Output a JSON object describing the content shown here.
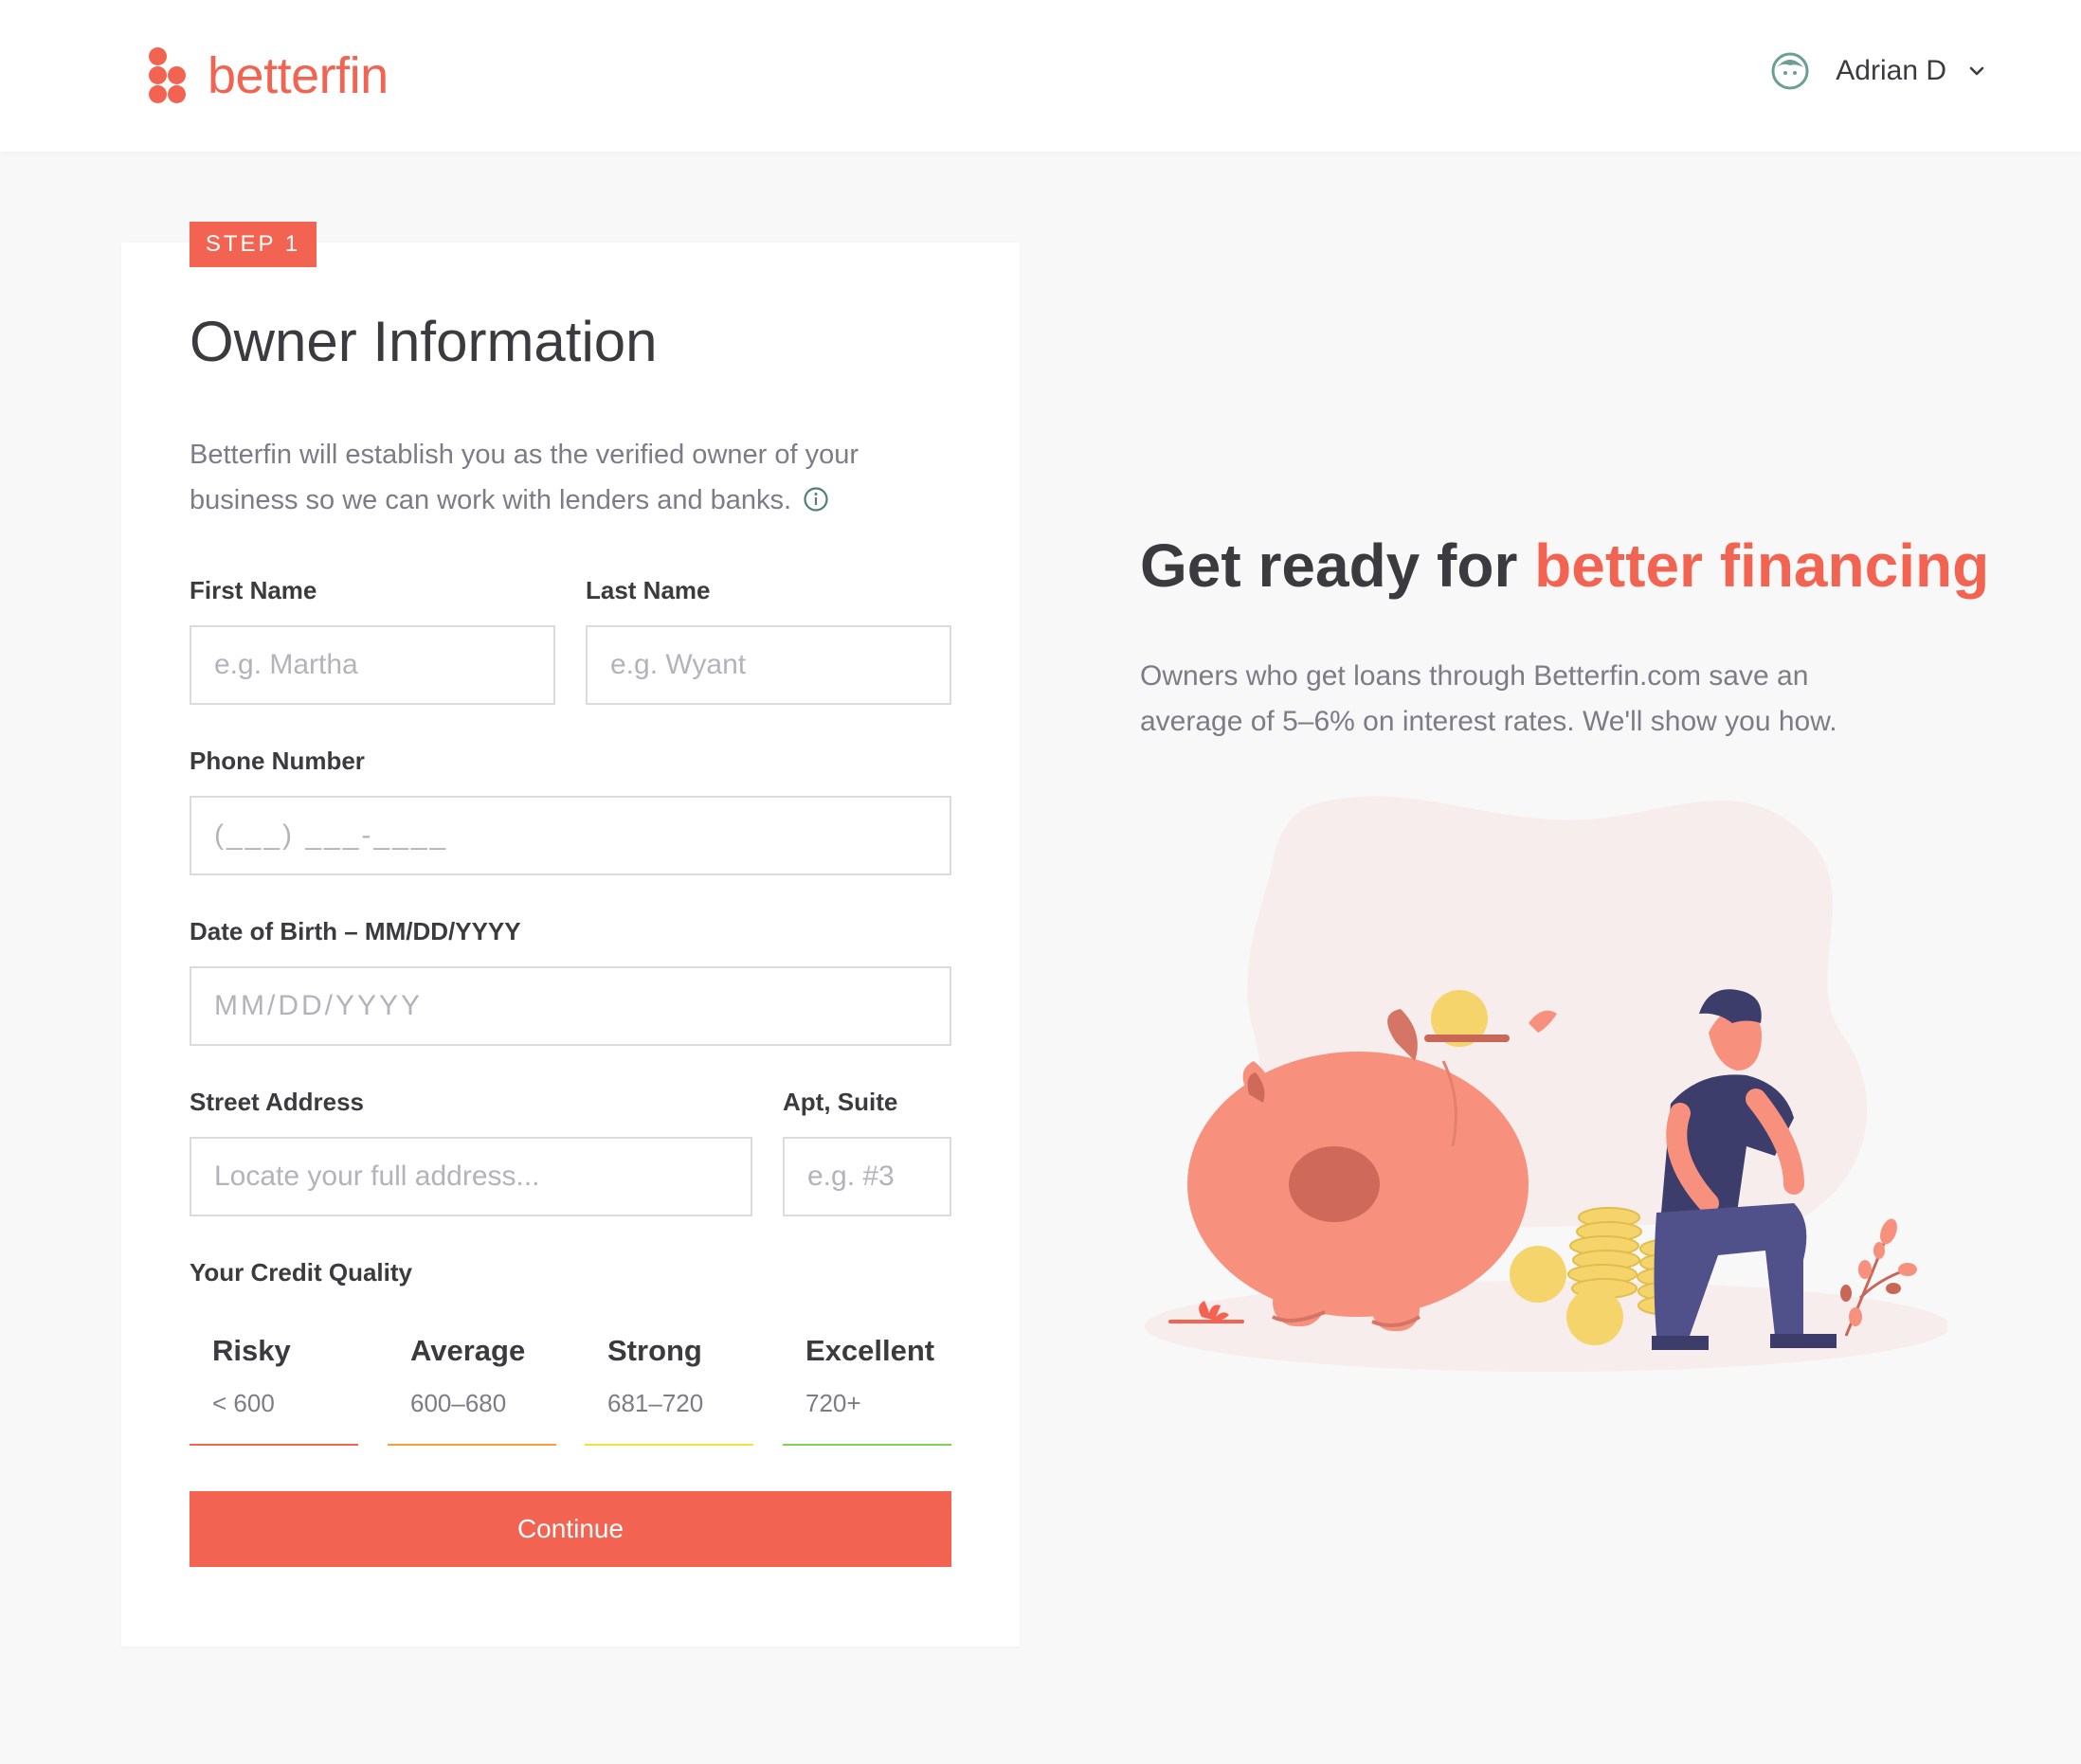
{
  "header": {
    "brand": "betterfin",
    "user_name": "Adrian D"
  },
  "form": {
    "step_label": "STEP 1",
    "title": "Owner Information",
    "description": "Betterfin will establish you as the verified owner of your business so we can work with lenders and banks.",
    "fields": {
      "first_name": {
        "label": "First Name",
        "placeholder": "e.g. Martha"
      },
      "last_name": {
        "label": "Last Name",
        "placeholder": "e.g. Wyant"
      },
      "phone": {
        "label": "Phone Number",
        "placeholder": "(___) ___-____"
      },
      "dob": {
        "label": "Date of Birth – MM/DD/YYYY",
        "placeholder": "MM/DD/YYYY"
      },
      "street": {
        "label": "Street Address",
        "placeholder": "Locate your full address..."
      },
      "apt": {
        "label": "Apt, Suite",
        "placeholder": "e.g. #3"
      }
    },
    "credit": {
      "label": "Your Credit Quality",
      "options": [
        {
          "name": "Risky",
          "range": "< 600",
          "color": "#f26451"
        },
        {
          "name": "Average",
          "range": "600–680",
          "color": "#f5a03c"
        },
        {
          "name": "Strong",
          "range": "681–720",
          "color": "#f3e13a"
        },
        {
          "name": "Excellent",
          "range": "720+",
          "color": "#7ed357"
        }
      ]
    },
    "continue_label": "Continue"
  },
  "hero": {
    "title_plain": "Get ready for ",
    "title_accent": "better financing",
    "description": "Owners who get loans through Betterfin.com save an average of 5–6% on interest rates. We'll show you how."
  },
  "colors": {
    "brand": "#f26451",
    "background": "#f8f8f8",
    "text": "#3a3a3f",
    "muted": "#7c7c86"
  },
  "icons": {
    "logo": "betterfin-dots-logo",
    "avatar": "user-avatar-icon",
    "chevron": "chevron-down-icon",
    "info": "info-icon"
  }
}
